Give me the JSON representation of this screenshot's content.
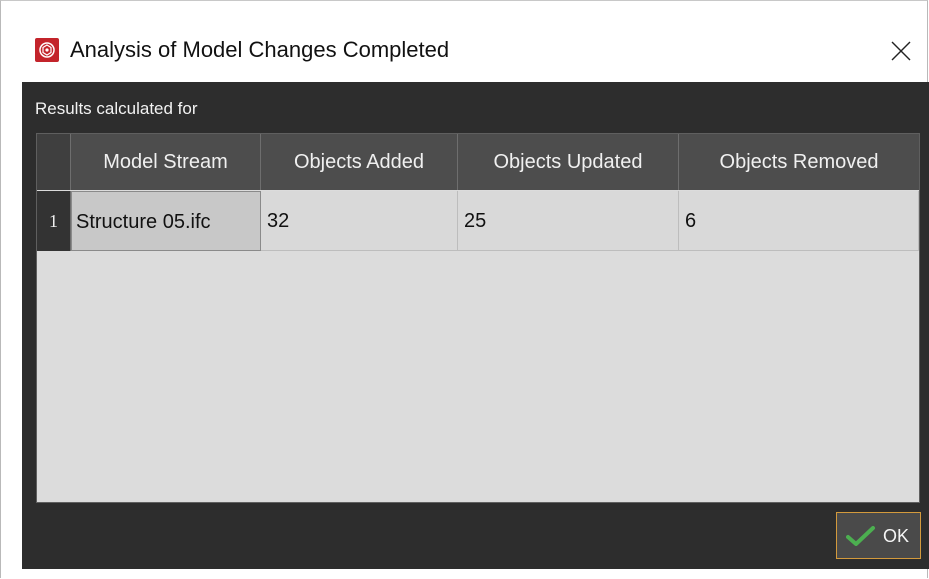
{
  "window": {
    "title": "Analysis of Model Changes Completed",
    "app_icon": "app-logo-icon",
    "close_icon": "close-icon"
  },
  "panel": {
    "label": "Results calculated for"
  },
  "table": {
    "columns": [
      "Model Stream",
      "Objects Added",
      "Objects Updated",
      "Objects Removed"
    ],
    "rows": [
      {
        "number": "1",
        "cells": [
          "Structure 05.ifc",
          "32",
          "25",
          "6"
        ]
      }
    ]
  },
  "footer": {
    "ok_label": "OK",
    "ok_icon": "checkmark-icon"
  },
  "colors": {
    "accent_red": "#c3242b",
    "dark_bg": "#2d2d2d",
    "header_bg": "#4d4d4d",
    "grid_bg": "#dcdcdc",
    "ok_border": "#d39a3c",
    "check_green": "#4caf50"
  }
}
